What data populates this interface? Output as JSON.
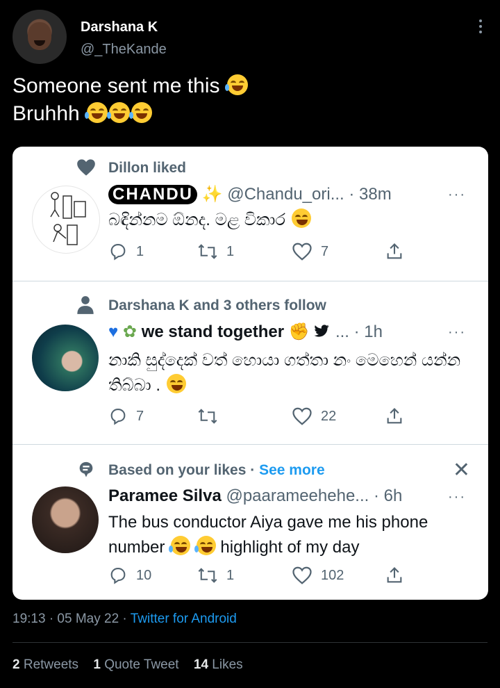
{
  "tweet": {
    "author_name": "Darshana K",
    "author_handle": "@_TheKande",
    "text_line1": "Someone sent me this",
    "text_line2": "Bruhhh",
    "timestamp": "19:13 · 05 May 22 · ",
    "source": "Twitter for Android",
    "stats": {
      "retweets_count": "2",
      "retweets_label": "Retweets",
      "quotes_count": "1",
      "quotes_label": "Quote Tweet",
      "likes_count": "14",
      "likes_label": "Likes"
    }
  },
  "feed": [
    {
      "context": "Dillon liked",
      "context_icon": "heart-icon",
      "name": "CHANDU",
      "handle": "@Chandu_ori... · 38m",
      "text": "බඳින්නම ඕනද. මළ විකාර",
      "replies": "1",
      "retweets": "1",
      "likes": "7"
    },
    {
      "context": "Darshana K and 3 others follow",
      "context_icon": "person-icon",
      "name": "we stand together",
      "handle": "... · 1h",
      "text": "නාකි සුද්දෙක් වත් හොයා ගත්තා නං මෙහෙන් යන්න තිබ්බා .",
      "replies": "7",
      "retweets": "",
      "likes": "22"
    },
    {
      "context": "Based on your likes",
      "context_sep": " · ",
      "context_link": "See more",
      "context_icon": "speech-bubble-icon",
      "name": "Paramee Silva",
      "handle": "@paarameehehe... · 6h",
      "text_a": "The bus conductor Aiya gave me his phone number",
      "text_b": "highlight of my day",
      "replies": "10",
      "retweets": "1",
      "likes": "102"
    }
  ]
}
